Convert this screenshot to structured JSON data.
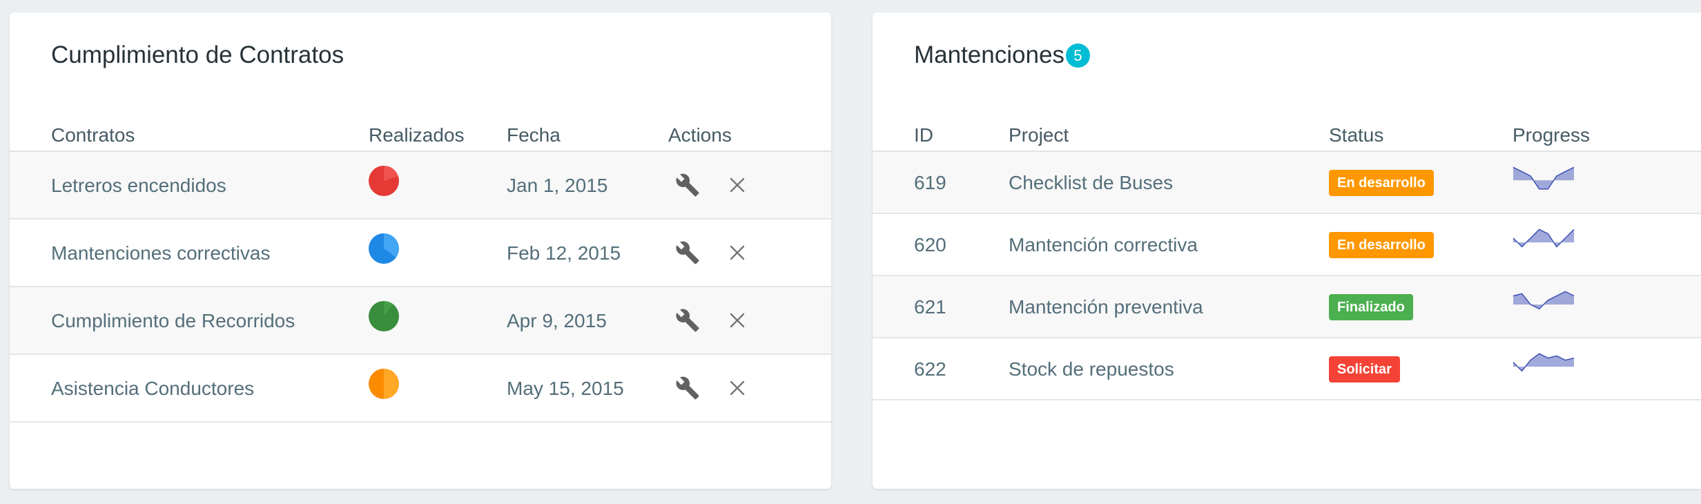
{
  "left": {
    "title": "Cumplimiento de Contratos",
    "headers": {
      "contratos": "Contratos",
      "realizados": "Realizados",
      "fecha": "Fecha",
      "actions": "Actions"
    },
    "rows": [
      {
        "name": "Letreros encendidos",
        "date": "Jan 1, 2015",
        "pie_color": "#e53935",
        "pie_light": "#ef5350",
        "pie_fraction": 0.2
      },
      {
        "name": "Mantenciones correctivas",
        "date": "Feb 12, 2015",
        "pie_color": "#1e88e5",
        "pie_light": "#42a5f5",
        "pie_fraction": 0.35
      },
      {
        "name": "Cumplimiento de Recorridos",
        "date": "Apr 9, 2015",
        "pie_color": "#388e3c",
        "pie_light": "#43a047",
        "pie_fraction": 0.1
      },
      {
        "name": "Asistencia Conductores",
        "date": "May 15, 2015",
        "pie_color": "#fb8c00",
        "pie_light": "#ffa726",
        "pie_fraction": 0.5
      }
    ],
    "icons": {
      "edit": "wrench-icon",
      "delete": "close-icon"
    }
  },
  "right": {
    "title": "Mantenciones",
    "count": "5",
    "headers": {
      "id": "ID",
      "project": "Project",
      "status": "Status",
      "progress": "Progress"
    },
    "rows": [
      {
        "id": "619",
        "project": "Checklist de Buses",
        "status": "En desarrollo",
        "status_color": "#ff9800",
        "spark": [
          6,
          4,
          2,
          -4,
          -4,
          2,
          4,
          6
        ]
      },
      {
        "id": "620",
        "project": "Mantención correctiva",
        "status": "En desarrollo",
        "status_color": "#ff9800",
        "spark": [
          2,
          -2,
          2,
          6,
          4,
          -2,
          2,
          6
        ]
      },
      {
        "id": "621",
        "project": "Mantención preventiva",
        "status": "Finalizado",
        "status_color": "#4caf50",
        "spark": [
          4,
          5,
          0,
          -2,
          2,
          4,
          6,
          4
        ]
      },
      {
        "id": "622",
        "project": "Stock de repuestos",
        "status": "Solicitar",
        "status_color": "#f44336",
        "spark": [
          2,
          -2,
          3,
          6,
          4,
          5,
          3,
          4
        ]
      }
    ],
    "spark_color": "#7986cb"
  }
}
